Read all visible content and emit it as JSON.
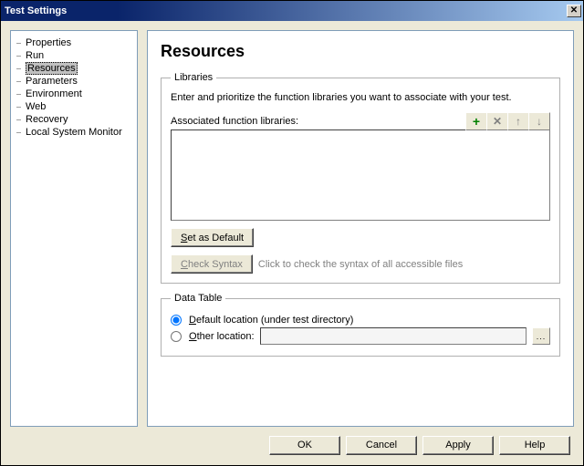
{
  "window": {
    "title": "Test Settings"
  },
  "nav": {
    "items": [
      {
        "label": "Properties",
        "selected": false
      },
      {
        "label": "Run",
        "selected": false
      },
      {
        "label": "Resources",
        "selected": true
      },
      {
        "label": "Parameters",
        "selected": false
      },
      {
        "label": "Environment",
        "selected": false
      },
      {
        "label": "Web",
        "selected": false
      },
      {
        "label": "Recovery",
        "selected": false
      },
      {
        "label": "Local System Monitor",
        "selected": false
      }
    ]
  },
  "page": {
    "heading": "Resources",
    "libraries": {
      "legend": "Libraries",
      "desc": "Enter and prioritize the function libraries you want to associate with your test.",
      "assoc_label": "Associated function libraries:",
      "set_default": "Set as Default",
      "check_syntax": "Check Syntax",
      "hint": "Click to check the syntax of all accessible files",
      "icons": {
        "add": "+",
        "delete": "✕",
        "up": "↑",
        "down": "↓"
      }
    },
    "datatable": {
      "legend": "Data Table",
      "default_label": "Default location (under test directory)",
      "other_label": "Other location:",
      "selected": "default",
      "other_path": ""
    }
  },
  "footer": {
    "ok": "OK",
    "cancel": "Cancel",
    "apply": "Apply",
    "help": "Help"
  }
}
